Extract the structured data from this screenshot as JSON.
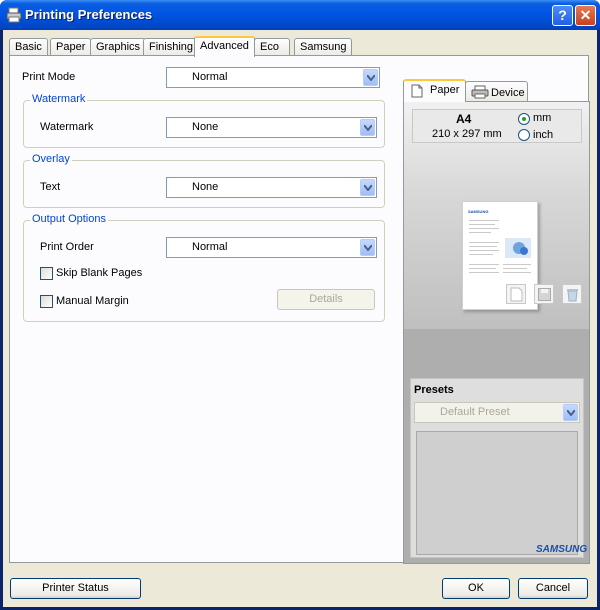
{
  "window": {
    "title": "Printing Preferences",
    "help_label": "?",
    "close_label": "✕"
  },
  "tabs": [
    {
      "label": "Basic"
    },
    {
      "label": "Paper"
    },
    {
      "label": "Graphics"
    },
    {
      "label": "Finishing"
    },
    {
      "label": "Advanced",
      "selected": true
    },
    {
      "label": "Eco"
    },
    {
      "label": "Samsung"
    }
  ],
  "advanced": {
    "print_mode": {
      "label": "Print Mode",
      "value": "Normal"
    },
    "watermark_group": {
      "title": "Watermark",
      "label": "Watermark",
      "value": "None"
    },
    "overlay_group": {
      "title": "Overlay",
      "label": "Text",
      "value": "None"
    },
    "output_group": {
      "title": "Output Options",
      "print_order_label": "Print Order",
      "print_order_value": "Normal",
      "skip_blank_label": "Skip Blank Pages",
      "skip_blank_checked": false,
      "manual_margin_label": "Manual Margin",
      "manual_margin_checked": false,
      "details_label": "Details"
    }
  },
  "preview": {
    "tabs": [
      {
        "label": "Paper",
        "selected": true
      },
      {
        "label": "Device",
        "selected": false
      }
    ],
    "paper_size": "A4",
    "paper_dims": "210 x 297 mm",
    "units": [
      {
        "label": "mm",
        "selected": true
      },
      {
        "label": "inch",
        "selected": false
      }
    ],
    "presets_title": "Presets",
    "preset_value": "Default Preset",
    "brand": "SAMSUNG",
    "thumb_brand": "SAMSUNG"
  },
  "footer": {
    "printer_status_label": "Printer Status",
    "ok_label": "OK",
    "cancel_label": "Cancel"
  },
  "colors": {
    "titlebar": "#0055e5",
    "group_title": "#0046d5",
    "tab_highlight": "#ffc83c",
    "brand_blue": "#1c4ea6"
  }
}
